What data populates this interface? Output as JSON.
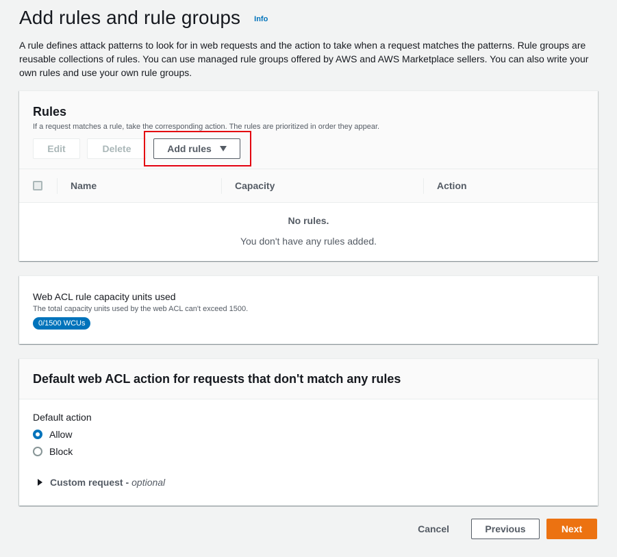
{
  "header": {
    "title": "Add rules and rule groups",
    "info": "Info",
    "description": "A rule defines attack patterns to look for in web requests and the action to take when a request matches the patterns. Rule groups are reusable collections of rules. You can use managed rule groups offered by AWS and AWS Marketplace sellers. You can also write your own rules and use your own rule groups."
  },
  "rules": {
    "title": "Rules",
    "subtitle": "If a request matches a rule, take the corresponding action. The rules are prioritized in order they appear.",
    "edit_label": "Edit",
    "delete_label": "Delete",
    "add_label": "Add rules",
    "columns": [
      "Name",
      "Capacity",
      "Action"
    ],
    "empty_title": "No rules.",
    "empty_desc": "You don't have any rules added."
  },
  "capacity": {
    "title": "Web ACL rule capacity units used",
    "subtitle": "The total capacity units used by the web ACL can't exceed 1500.",
    "badge": "0/1500 WCUs"
  },
  "default_action": {
    "title": "Default web ACL action for requests that don't match any rules",
    "label": "Default action",
    "options": [
      "Allow",
      "Block"
    ],
    "selected": "Allow",
    "expander_label": "Custom request -",
    "expander_optional": "optional"
  },
  "footer": {
    "cancel": "Cancel",
    "previous": "Previous",
    "next": "Next"
  },
  "colors": {
    "accent": "#0073bb",
    "primary_button": "#ec7211",
    "highlight": "#e3000f"
  }
}
